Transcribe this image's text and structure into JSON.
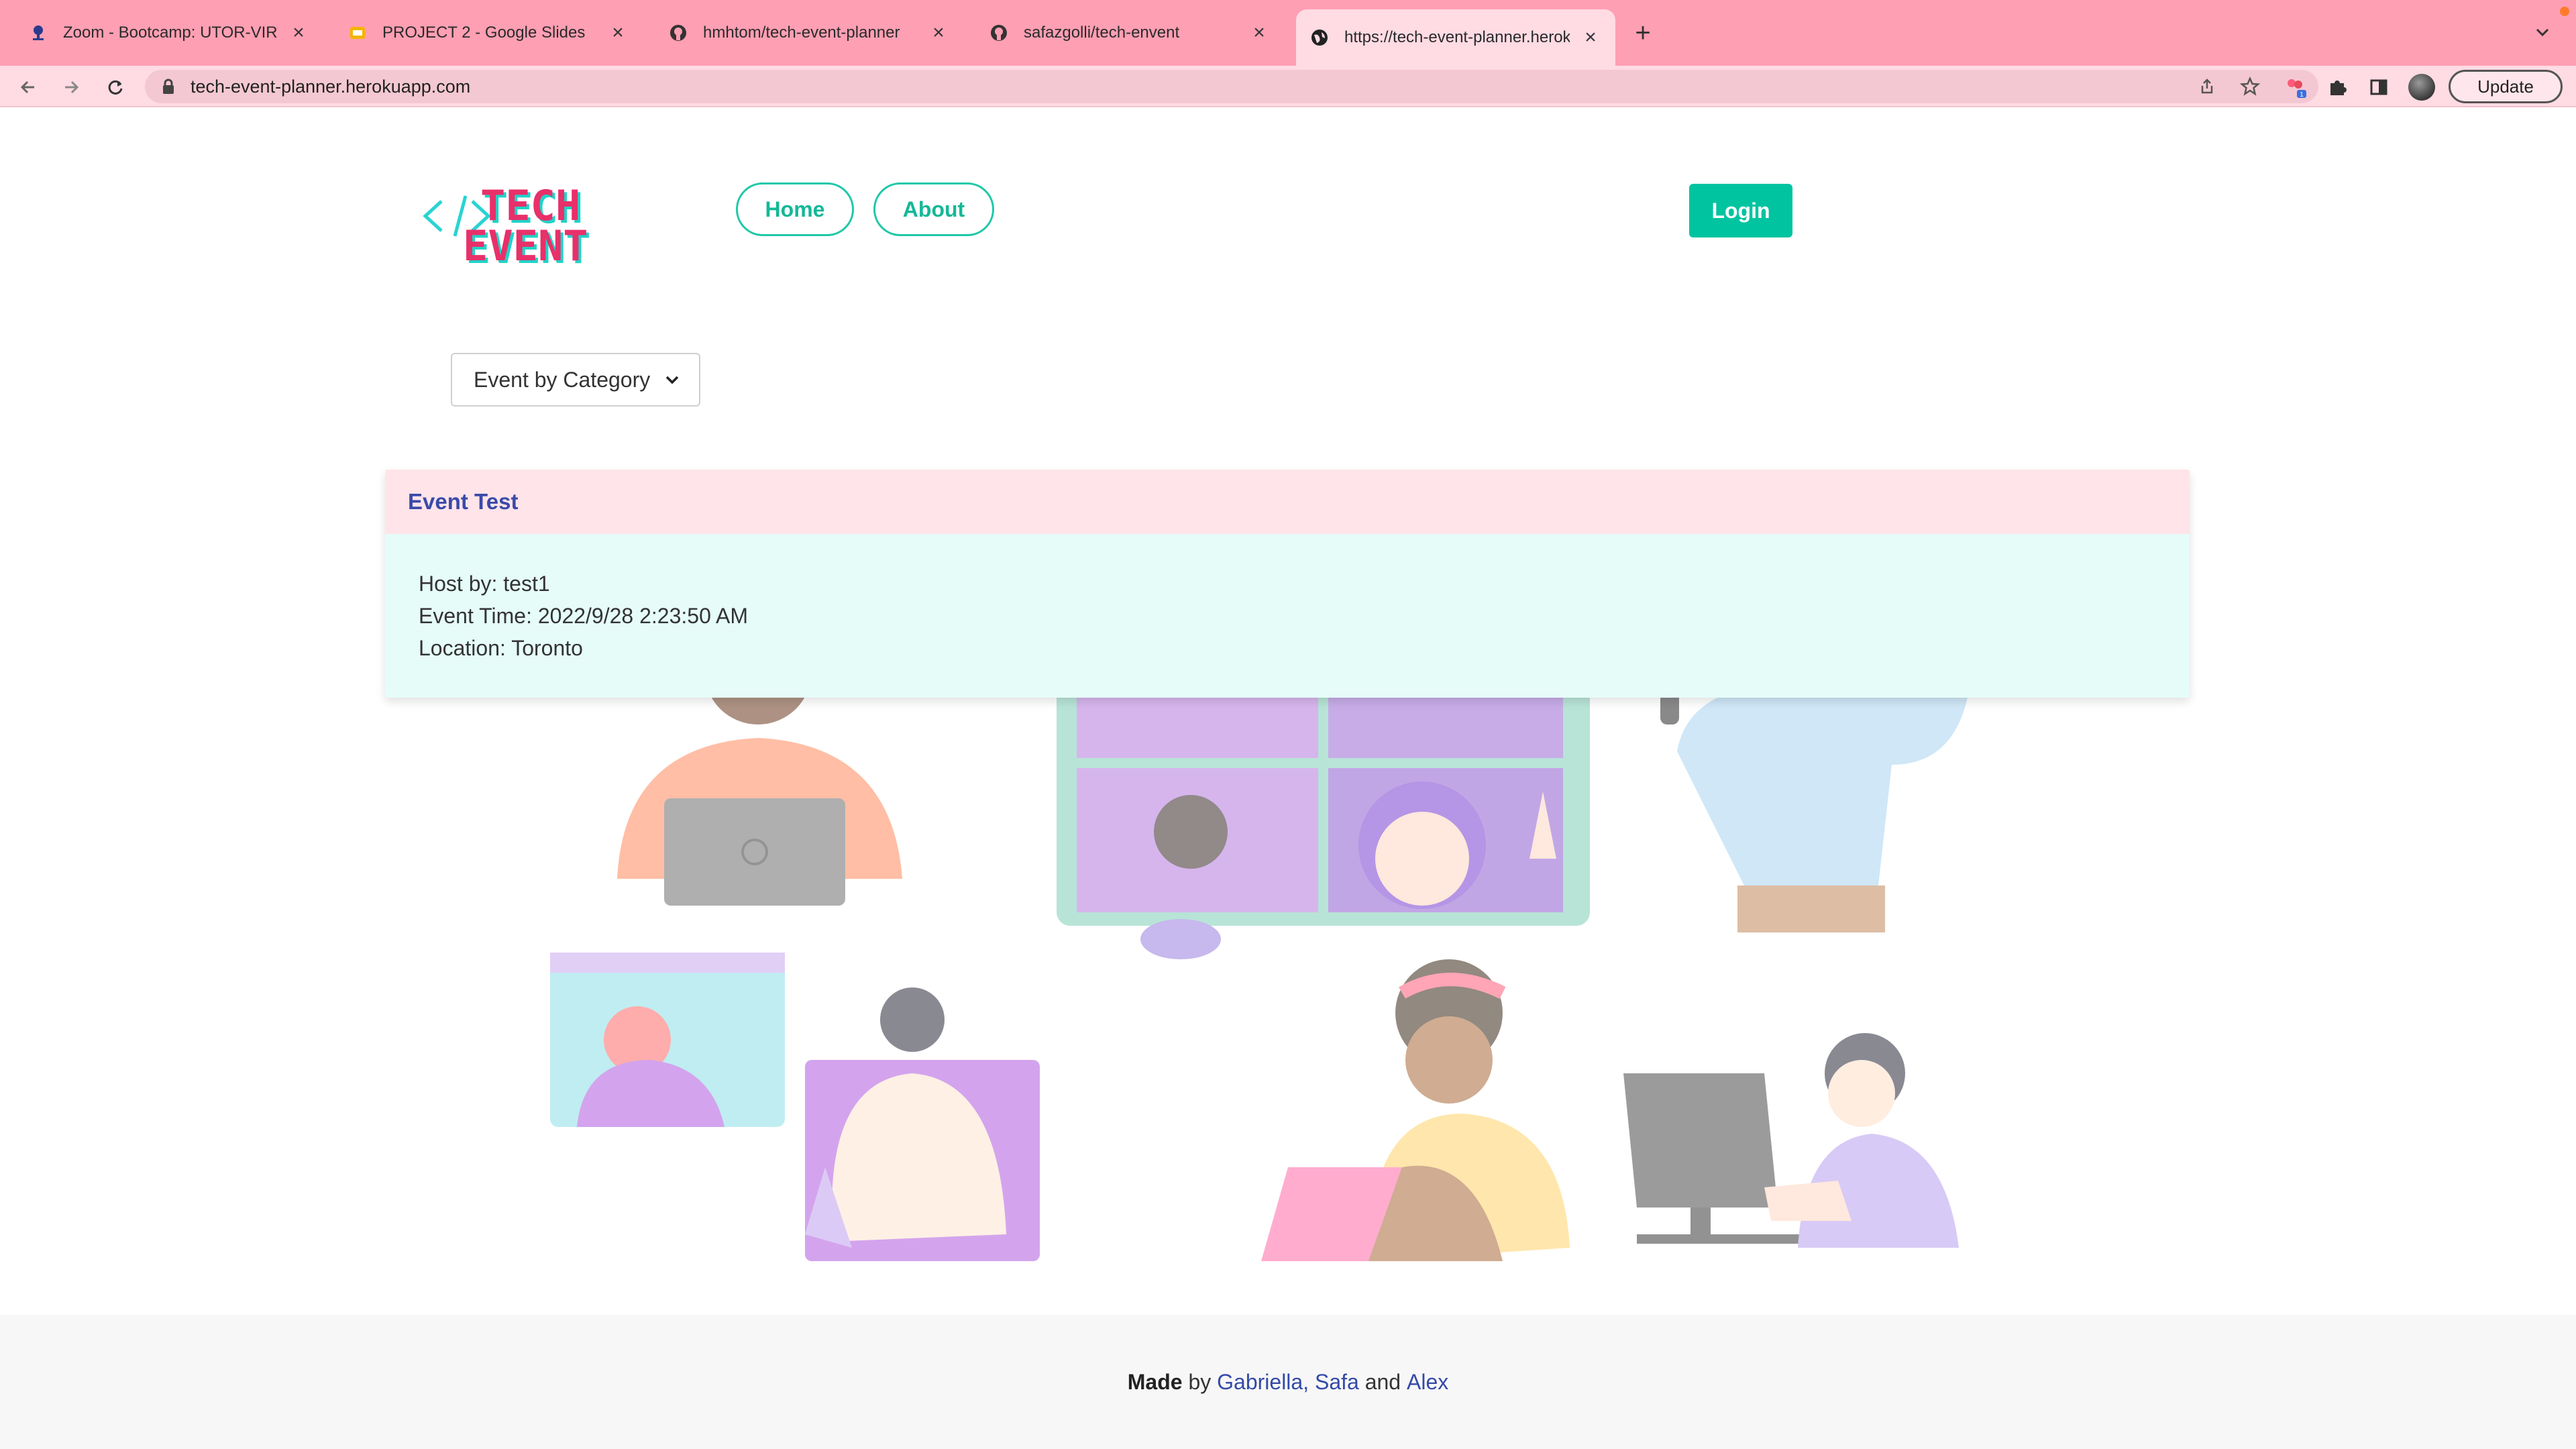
{
  "browser": {
    "tabs": [
      {
        "title": "Zoom - Bootcamp: UTOR-VIRT",
        "icon": "zoom-icon"
      },
      {
        "title": "PROJECT 2 - Google Slides",
        "icon": "slides-icon"
      },
      {
        "title": "hmhtom/tech-event-planner",
        "icon": "github-icon"
      },
      {
        "title": "safazgolli/tech-envent",
        "icon": "github-icon"
      },
      {
        "title": "https://tech-event-planner.herokuapp.com",
        "icon": "globe-icon",
        "active": true
      }
    ],
    "new_tab": "+",
    "url": "tech-event-planner.herokuapp.com",
    "update_label": "Update",
    "extension_badge": "1"
  },
  "site": {
    "logo_text": [
      "TECH",
      "EVENT"
    ],
    "nav": {
      "home": "Home",
      "about": "About"
    },
    "login": "Login",
    "category_dropdown": "Event by Category"
  },
  "event": {
    "title": "Event Test",
    "host": "Host by: test1",
    "time": "Event Time: 2022/9/28 2:23:50 AM",
    "location": "Location: Toronto"
  },
  "footer": {
    "made": "Made",
    "by": "by",
    "names1": "Gabriella, Safa",
    "and": "and",
    "names2": "Alex"
  },
  "colors": {
    "tabbar": "#ff9fb3",
    "toolbar": "#ffdbe4",
    "accent": "#00c4a0",
    "event_header": "#ffe4ea",
    "event_body": "#e6fcf8",
    "link": "#3449a8"
  }
}
